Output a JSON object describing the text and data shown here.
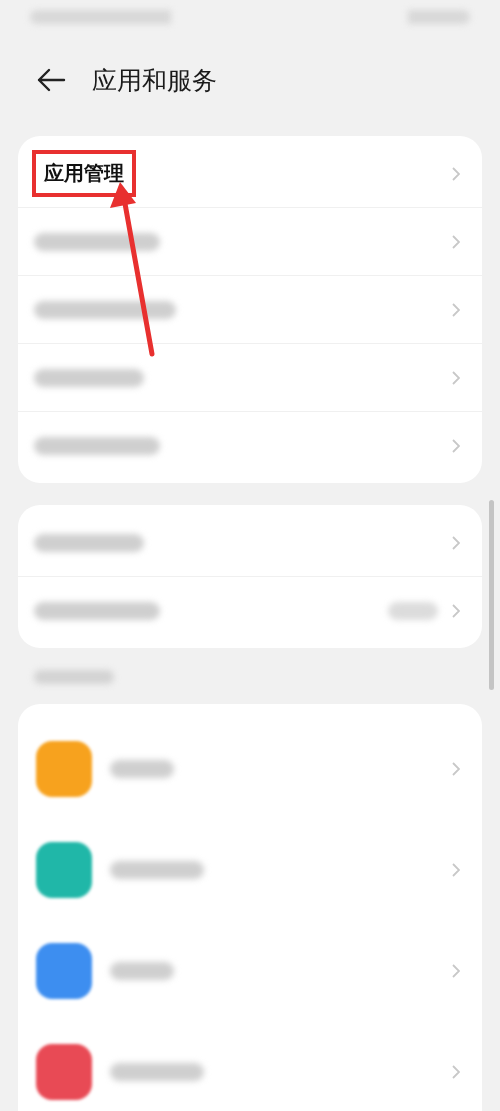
{
  "header": {
    "title": "应用和服务"
  },
  "groups": [
    {
      "items": [
        {
          "kind": "text",
          "label": "应用管理",
          "highlighted": true
        },
        {
          "kind": "blurred"
        },
        {
          "kind": "blurred"
        },
        {
          "kind": "blurred"
        },
        {
          "kind": "blurred"
        }
      ]
    },
    {
      "items": [
        {
          "kind": "blurred"
        },
        {
          "kind": "blurred-value"
        }
      ]
    }
  ],
  "apps": [
    {
      "color": "#f7a21e"
    },
    {
      "color": "#20b7a8"
    },
    {
      "color": "#3d8ef0"
    },
    {
      "color": "#e84a55"
    }
  ]
}
